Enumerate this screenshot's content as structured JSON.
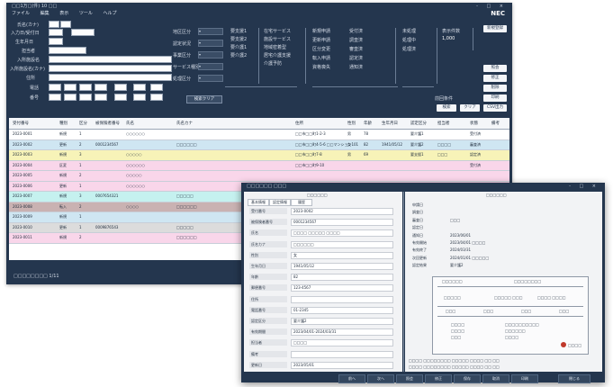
{
  "main": {
    "title": "□□1万□(件) 10 □□",
    "brand": "NEC",
    "window_controls": "- □ ×",
    "menu": [
      "ファイル",
      "編集",
      "表示",
      "ツール",
      "ヘルプ"
    ],
    "search": {
      "labels": [
        "氏名(カナ)",
        "入力日/受付日",
        "生年月日",
        "担当者",
        "入所施設名",
        "入所施設名(カナ)",
        "住所",
        "電話",
        "番号"
      ],
      "mid_labels": [
        "地区区分",
        "認定状況",
        "事業区分",
        "サービス種別",
        "処理区分"
      ],
      "search_button": "検索クリア",
      "check_group1": [
        "要支援1",
        "要支援2",
        "要介護1",
        "要介護2"
      ],
      "check_group2": [
        "在宅サービス",
        "施設サービス",
        "地域密着型",
        "居宅介護支援",
        "介護予防"
      ],
      "check_group3": [
        "新規申請",
        "更新申請",
        "区分変更",
        "転入申請",
        "資格喪失"
      ],
      "check_group4": [
        "受付済",
        "調査済",
        "審査済",
        "認定済",
        "通知済"
      ],
      "check_group5": [
        "未処理",
        "処理中",
        "処理済"
      ],
      "right_label": "表示件数",
      "right_value": "1,000",
      "right_buttons": [
        "新規登録",
        "照会",
        "修正",
        "削除",
        "印刷",
        "CSV出力"
      ],
      "bottom_buttons": [
        "検索",
        "前回条件",
        "クリア"
      ]
    },
    "grid": {
      "headers": [
        "受付番号",
        "種別",
        "区分",
        "被保険者番号",
        "氏名",
        "氏名カナ",
        "住所",
        "性別",
        "年齢",
        "生年月日",
        "認定区分",
        "担当者",
        "状態",
        "備考"
      ],
      "rows": [
        {
          "c0": "2023-0001",
          "c1": "新規",
          "c2": "1",
          "c3": "",
          "c4": "○○○○○○",
          "c5": "",
          "c6": "□□市□□町1-2-3",
          "c7": "男",
          "c8": "78",
          "c9": "",
          "c10": "要介護1",
          "c11": "",
          "c12": "受付済",
          "bg": "#ffffff"
        },
        {
          "c0": "2023-0002",
          "c1": "更新",
          "c2": "2",
          "c3": "0001234567",
          "c4": "",
          "c5": "□□□□□□",
          "c6": "□□市□□町4-5-6 □□マンション101",
          "c7": "女",
          "c8": "82",
          "c9": "1941/05/12",
          "c10": "要介護2",
          "c11": "□□□□",
          "c12": "審査済",
          "bg": "#cfe6f2"
        },
        {
          "c0": "2023-0003",
          "c1": "新規",
          "c2": "3",
          "c3": "",
          "c4": "○○○○○",
          "c5": "",
          "c6": "□□市□□町7-8",
          "c7": "男",
          "c8": "69",
          "c9": "",
          "c10": "要支援1",
          "c11": "□□□",
          "c12": "認定済",
          "bg": "#f7f3b8"
        },
        {
          "c0": "2023-0004",
          "c1": "区変",
          "c2": "1",
          "c3": "",
          "c4": "○○○○○○",
          "c5": "",
          "c6": "□□市□□町9-10",
          "c7": "",
          "c8": "",
          "c9": "",
          "c10": "",
          "c11": "",
          "c12": "受付済",
          "bg": "#f9d6ea"
        },
        {
          "c0": "2023-0005",
          "c1": "新規",
          "c2": "2",
          "c3": "",
          "c4": "○○○○○",
          "c5": "",
          "c6": "",
          "c7": "",
          "c8": "",
          "c9": "",
          "c10": "",
          "c11": "",
          "c12": "",
          "bg": "#f9d6ea"
        },
        {
          "c0": "2023-0006",
          "c1": "更新",
          "c2": "1",
          "c3": "",
          "c4": "○○○○○○",
          "c5": "",
          "c6": "",
          "c7": "",
          "c8": "",
          "c9": "",
          "c10": "",
          "c11": "",
          "c12": "",
          "bg": "#f9d6ea"
        },
        {
          "c0": "2023-0007",
          "c1": "新規",
          "c2": "3",
          "c3": "0007654321",
          "c4": "",
          "c5": "□□□□□",
          "c6": "",
          "c7": "",
          "c8": "",
          "c9": "",
          "c10": "",
          "c11": "",
          "c12": "",
          "bg": "#c5f1ef"
        },
        {
          "c0": "2023-0008",
          "c1": "転入",
          "c2": "2",
          "c3": "",
          "c4": "○○○○",
          "c5": "□□□□□□",
          "c6": "",
          "c7": "",
          "c8": "",
          "c9": "",
          "c10": "",
          "c11": "",
          "c12": "",
          "bg": "#c9b2b2"
        },
        {
          "c0": "2023-0009",
          "c1": "新規",
          "c2": "1",
          "c3": "",
          "c4": "",
          "c5": "",
          "c6": "",
          "c7": "",
          "c8": "",
          "c9": "",
          "c10": "",
          "c11": "",
          "c12": "",
          "bg": "#cfe6f2"
        },
        {
          "c0": "2023-0010",
          "c1": "更新",
          "c2": "1",
          "c3": "0009876543",
          "c4": "",
          "c5": "□□□□□",
          "c6": "",
          "c7": "",
          "c8": "",
          "c9": "",
          "c10": "",
          "c11": "",
          "c12": "",
          "bg": "#dcdcdc"
        },
        {
          "c0": "2023-0011",
          "c1": "新規",
          "c2": "2",
          "c3": "",
          "c4": "",
          "c5": "□□□□□□",
          "c6": "",
          "c7": "",
          "c8": "",
          "c9": "",
          "c10": "",
          "c11": "",
          "c12": "",
          "bg": "#f9d6ea"
        }
      ]
    },
    "footer": "□□□□□□□□ 1/11"
  },
  "detail": {
    "title": "□□□□□□ □□□",
    "brand": "NEC",
    "window_controls": "- □ ×",
    "left_header": "□□□□□□",
    "right_header": "□□□□□□",
    "tabs": [
      "基本情報",
      "認定情報",
      "履歴"
    ],
    "fields": [
      {
        "label": "受付番号",
        "value": "2023-0002"
      },
      {
        "label": "被保険者番号",
        "value": "0001234567"
      },
      {
        "label": "氏名",
        "value": "□□□□ □□□□□ □□□□"
      },
      {
        "label": "氏名カナ",
        "value": "□□□□□□"
      },
      {
        "label": "性別",
        "value": "女"
      },
      {
        "label": "生年月日",
        "value": "1941/05/12"
      },
      {
        "label": "年齢",
        "value": "82"
      },
      {
        "label": "郵便番号",
        "value": "123-4567"
      },
      {
        "label": "住所",
        "value": ""
      },
      {
        "label": "電話番号",
        "value": "01-2345"
      },
      {
        "label": "認定区分",
        "value": "要介護2"
      },
      {
        "label": "有効期間",
        "value": "2023/04/01-2024/03/31"
      },
      {
        "label": "担当者",
        "value": "□□□□"
      },
      {
        "label": "備考",
        "value": ""
      },
      {
        "label": "更新日",
        "value": "2023/05/01"
      }
    ],
    "right_labels": [
      {
        "label": "申請日",
        "value": ""
      },
      {
        "label": "調査日",
        "value": ""
      },
      {
        "label": "審査日",
        "value": "□□□"
      },
      {
        "label": "認定日",
        "value": ""
      },
      {
        "label": "通知日",
        "value": "2023/06/01"
      },
      {
        "label": "有効開始",
        "value": "2023/04/01 □□□□"
      },
      {
        "label": "有効終了",
        "value": "2024/03/31"
      },
      {
        "label": "次回更新",
        "value": "2024/01/01 □□□□□"
      },
      {
        "label": "認定結果",
        "value": "要介護2"
      }
    ],
    "diagram": {
      "top": "□□□□□□",
      "top_right": "□□□□□□□□",
      "mid_left": "□□□□□",
      "mid_mid": "□□□□□ □□□",
      "mid_right": "□□□□ □□□□",
      "cells": [
        "□□□",
        "□□□",
        "□□□",
        "□□□"
      ],
      "bottom_left": [
        "□□□□",
        "□□□□",
        "□□□"
      ],
      "bottom_right": [
        "□□□□□□□□□□",
        "□□□□□□",
        "□□□□"
      ],
      "stamp": "□□□□"
    },
    "notes": [
      "□□□□ □□□□□□□□ □□□□□ □□□□ □□ □□",
      "□□□□ □□□□□□□□ □□□□□ □□□□ □□ □□"
    ],
    "taskbar": [
      "前へ",
      "次へ",
      "照会",
      "修正",
      "保存",
      "取消",
      "印刷",
      "閉じる"
    ]
  }
}
